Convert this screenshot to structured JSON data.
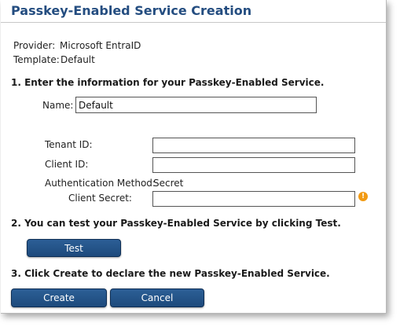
{
  "title": "Passkey-Enabled Service Creation",
  "info": {
    "provider_label": "Provider:",
    "provider_value": "Microsoft EntraID",
    "template_label": "Template:",
    "template_value": "Default"
  },
  "steps": {
    "step1": "1. Enter the information for your Passkey-Enabled Service.",
    "step2": "2. You can test your Passkey-Enabled Service by clicking Test.",
    "step3": "3. Click Create to declare the new Passkey-Enabled Service."
  },
  "form": {
    "name_label": "Name:",
    "name_value": "Default",
    "tenant_id_label": "Tenant ID:",
    "tenant_id_value": "",
    "client_id_label": "Client ID:",
    "client_id_value": "",
    "auth_method_label": "Authentication Method:",
    "auth_method_value": "Secret",
    "client_secret_label": "Client Secret:",
    "client_secret_value": ""
  },
  "buttons": {
    "test": "Test",
    "create": "Create",
    "cancel": "Cancel"
  },
  "icons": {
    "client_secret_warning": "warning-icon",
    "warning_glyph": "!"
  },
  "colors": {
    "title": "#244d80",
    "button": "#24558a",
    "warning": "#f29a12"
  }
}
